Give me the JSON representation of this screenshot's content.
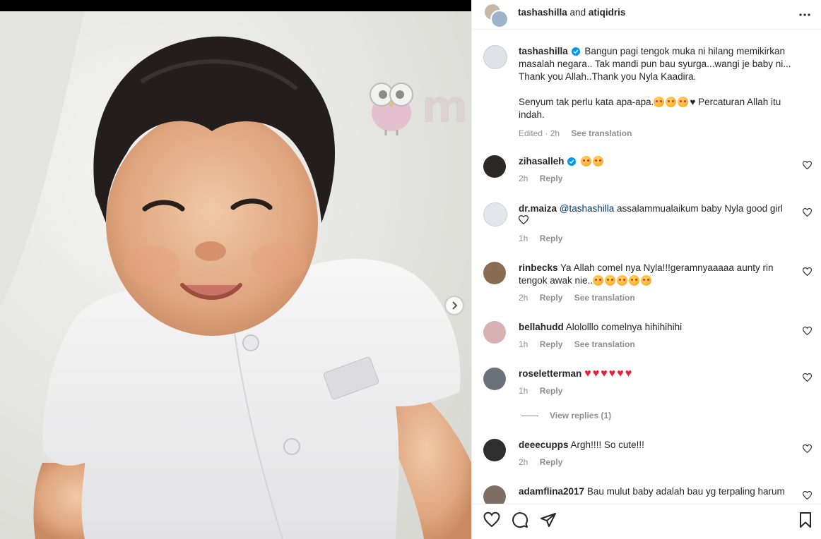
{
  "post": {
    "author": "tashashilla",
    "coauthor": "atiqidris",
    "and_text": "and",
    "watermark": "musai"
  },
  "caption": {
    "username": "tashashilla",
    "line1": "Bangun pagi tengok muka ni hilang memikirkan masalah negara.. Tak mandi pun bau syurga...wangi je baby ni... Thank you Allah..Thank you Nyla Kaadira.",
    "line2_pre": "Senyum tak perlu kata apa-apa.",
    "line2_post": " Percaturan Allah itu indah.",
    "meta_edited": "Edited · 2h",
    "see_translation": "See translation"
  },
  "comments": [
    {
      "username": "zihasalleh",
      "verified": true,
      "text": "",
      "time": "2h",
      "reply": "Reply"
    },
    {
      "username": "dr.maiza",
      "mention": "@tashashilla",
      "text": " assalammualaikum baby Nyla good girl",
      "time": "1h",
      "reply": "Reply"
    },
    {
      "username": "rinbecks",
      "text": "Ya Allah comel nya Nyla!!!geramnyaaaaa aunty rin tengok awak nie..",
      "time": "2h",
      "reply": "Reply",
      "translate": "See translation"
    },
    {
      "username": "bellahudd",
      "text": "Alololllo comelnya hihihihihi",
      "time": "1h",
      "reply": "Reply",
      "translate": "See translation"
    },
    {
      "username": "roseletterman",
      "text": "",
      "time": "1h",
      "reply": "Reply"
    },
    {
      "username": "deeecupps",
      "text": "Argh!!!! So cute!!!",
      "time": "2h",
      "reply": "Reply"
    },
    {
      "username": "adamflina2017",
      "text": "Bau mulut baby adalah bau yg terpaling harum"
    }
  ],
  "view_replies": "View replies (1)",
  "colors": {
    "accent_blue": "#0095f6",
    "link_dark": "#00376b",
    "heart_red": "#ed1e3a",
    "muted": "#8e8e8e"
  }
}
